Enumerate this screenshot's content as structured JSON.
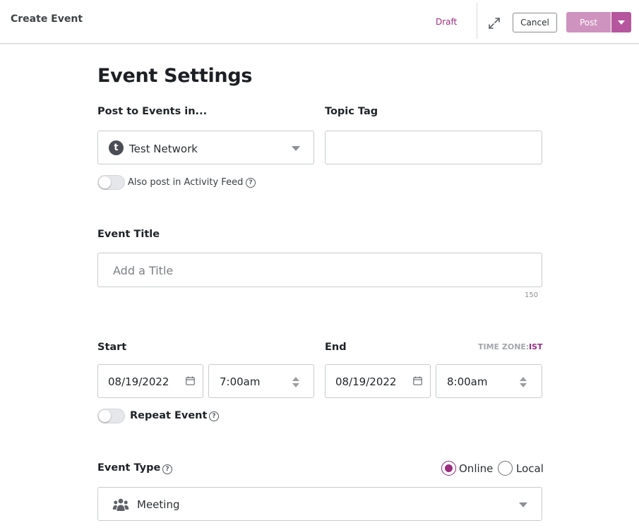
{
  "header": {
    "title": "Create Event",
    "draft_label": "Draft",
    "cancel_label": "Cancel",
    "post_label": "Post"
  },
  "page": {
    "heading": "Event Settings"
  },
  "post_to": {
    "label": "Post to Events in...",
    "network_initial": "t",
    "network_value": "Test Network"
  },
  "topic_tag": {
    "label": "Topic Tag",
    "value": ""
  },
  "activity_feed": {
    "label": "Also post in Activity Feed",
    "enabled": false
  },
  "event_title": {
    "label": "Event Title",
    "placeholder": "Add a Title",
    "char_limit": "150"
  },
  "start": {
    "label": "Start",
    "date": "08/19/2022",
    "time": "7:00am"
  },
  "end": {
    "label": "End",
    "date": "08/19/2022",
    "time": "8:00am"
  },
  "timezone": {
    "label": "TIME ZONE:",
    "value": "IST"
  },
  "repeat": {
    "label": "Repeat Event",
    "enabled": false
  },
  "event_type": {
    "label": "Event Type",
    "options": [
      "Online",
      "Local"
    ],
    "selected": "Online",
    "category_value": "Meeting"
  },
  "colors": {
    "accent": "#9c2c7f",
    "post_button": "#cf93bf",
    "post_dropdown": "#b6569e"
  }
}
